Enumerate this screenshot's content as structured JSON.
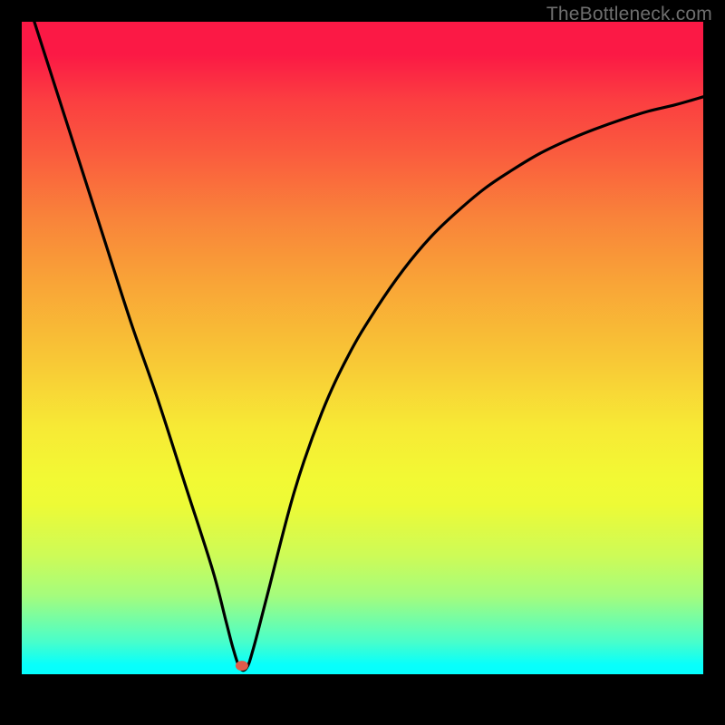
{
  "watermark": "TheBottleneck.com",
  "chart_data": {
    "type": "line",
    "title": "",
    "xlabel": "",
    "ylabel": "",
    "xlim": [
      0,
      100
    ],
    "ylim": [
      0,
      100
    ],
    "grid": false,
    "legend": false,
    "curve": {
      "x": [
        0,
        4,
        8,
        12,
        16,
        20,
        24,
        28,
        30,
        31,
        32,
        33,
        34,
        36,
        40,
        44,
        48,
        52,
        56,
        60,
        64,
        68,
        72,
        76,
        80,
        84,
        88,
        92,
        96,
        100
      ],
      "y_pct": [
        106,
        93,
        80,
        67,
        54,
        42,
        29,
        16,
        8,
        4,
        1,
        1,
        4,
        12,
        28,
        40,
        49,
        56,
        62,
        67,
        71,
        74.5,
        77.3,
        79.8,
        81.8,
        83.5,
        85,
        86.3,
        87.3,
        88.5
      ]
    },
    "marker": {
      "x": 32.3,
      "y_pct": 1.3,
      "color": "#e05a4a",
      "size": 11
    },
    "gradient_stops": [
      {
        "pos": 0.0,
        "color": "#fb1945"
      },
      {
        "pos": 0.05,
        "color": "#fb1945"
      },
      {
        "pos": 0.12,
        "color": "#fb3e41"
      },
      {
        "pos": 0.2,
        "color": "#fa5b3e"
      },
      {
        "pos": 0.3,
        "color": "#f9833a"
      },
      {
        "pos": 0.4,
        "color": "#f9a437"
      },
      {
        "pos": 0.52,
        "color": "#f8c836"
      },
      {
        "pos": 0.62,
        "color": "#f7e935"
      },
      {
        "pos": 0.7,
        "color": "#f2f934"
      },
      {
        "pos": 0.74,
        "color": "#edfa36"
      },
      {
        "pos": 0.82,
        "color": "#ccfb58"
      },
      {
        "pos": 0.88,
        "color": "#a4fc7d"
      },
      {
        "pos": 0.95,
        "color": "#49feca"
      },
      {
        "pos": 0.985,
        "color": "#08fffb"
      },
      {
        "pos": 1.0,
        "color": "#05fffe"
      }
    ]
  }
}
